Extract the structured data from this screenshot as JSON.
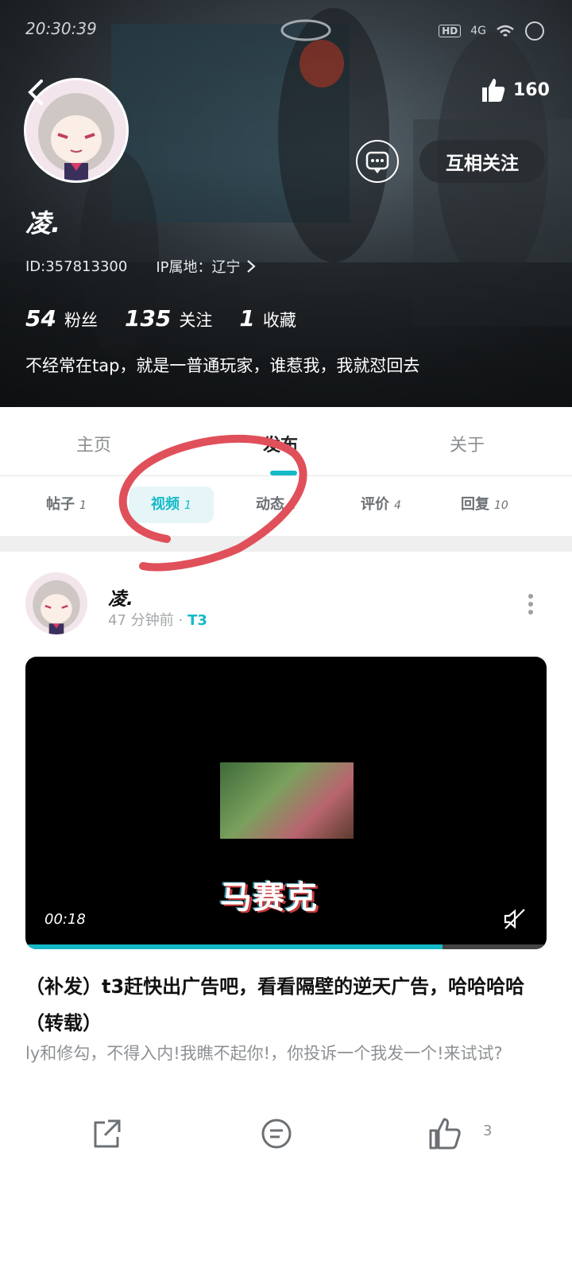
{
  "status_bar": {
    "time": "20:30:39",
    "hd": "HD",
    "network": "4G"
  },
  "profile": {
    "name": "凌.",
    "id_label": "ID:357813300",
    "ip_label": "IP属地：辽宁",
    "likes": "160",
    "follow_button": "互相关注",
    "stats": [
      {
        "value": "54",
        "label": "粉丝"
      },
      {
        "value": "135",
        "label": "关注"
      },
      {
        "value": "1",
        "label": "收藏"
      }
    ],
    "bio": "不经常在tap，就是一普通玩家，谁惹我，我就怼回去"
  },
  "tabs": [
    {
      "label": "主页"
    },
    {
      "label": "发布"
    },
    {
      "label": "关于"
    }
  ],
  "subtabs": [
    {
      "label": "帖子",
      "count": "1"
    },
    {
      "label": "视频",
      "count": "1"
    },
    {
      "label": "动态",
      "count": "1"
    },
    {
      "label": "评价",
      "count": "4"
    },
    {
      "label": "回复",
      "count": "10"
    }
  ],
  "post": {
    "author": "凌.",
    "time": "47 分钟前 ·",
    "level": "T3",
    "video_overlay_text": "马赛克",
    "video_time": "00:18",
    "progress": 0.8,
    "title": "（补发）t3赶快出广告吧，看看隔壁的逆天广告，哈哈哈哈（转载）",
    "excerpt": "ly和修勾，不得入内!我瞧不起你!，你投诉一个我发一个!来试试?",
    "like_count": "3"
  },
  "colors": {
    "accent": "#14b9c8",
    "annotation": "#e0505a"
  }
}
